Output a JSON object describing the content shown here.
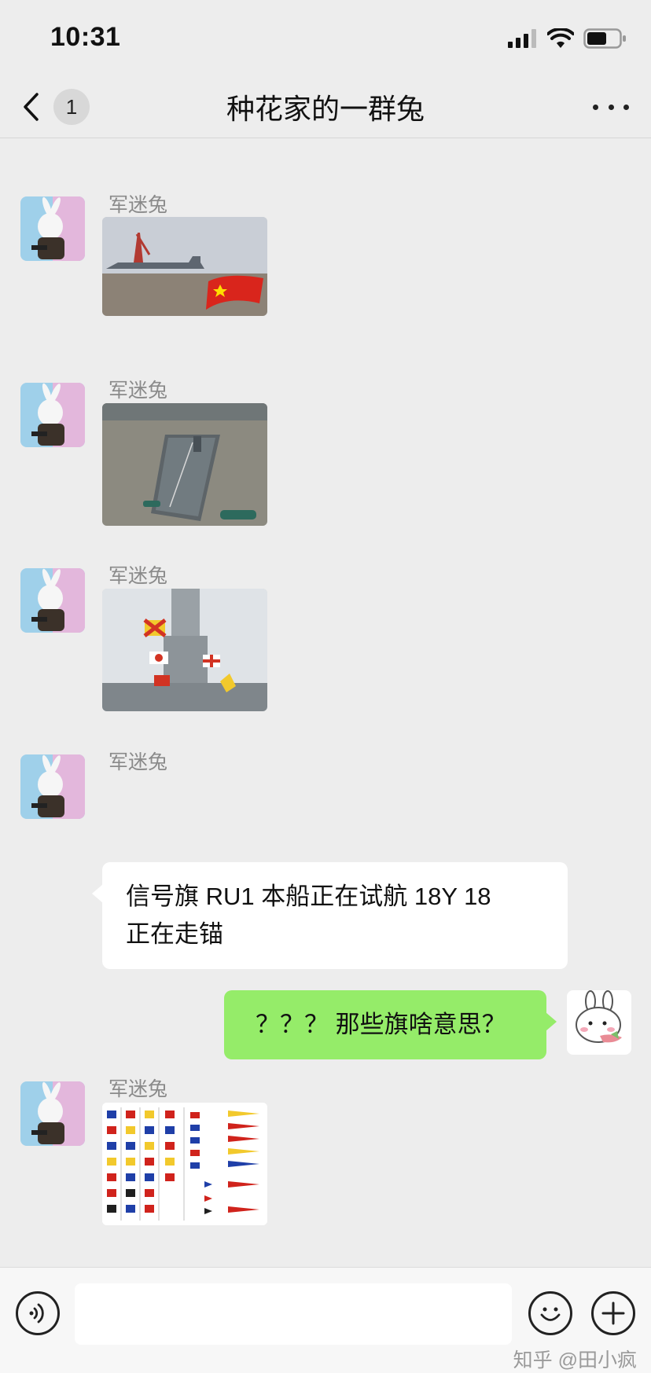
{
  "status_bar": {
    "time": "10:31"
  },
  "nav": {
    "unread_count": "1",
    "title": "种花家的一群兔"
  },
  "messages": {
    "m1": {
      "sender": "军迷兔"
    },
    "m2": {
      "sender": "军迷兔"
    },
    "m3": {
      "sender": "军迷兔"
    },
    "m4": {
      "sender": "军迷兔",
      "line1": "信号旗 RU1 本船正在试航 18Y 18",
      "line2": "正在走锚"
    },
    "m5": {
      "text": "？？？ 那些旗啥意思？"
    },
    "m6": {
      "sender": "军迷兔"
    }
  },
  "input_bar": {
    "placeholder": "",
    "watermark": "知乎 @田小疯"
  },
  "icons": {
    "back": "chevron-left-icon",
    "more": "more-dots-icon",
    "voice": "voice-icon",
    "emoji": "emoji-icon",
    "plus": "plus-icon"
  },
  "colors": {
    "background": "#ededed",
    "my_bubble": "#95ec69",
    "other_bubble": "#ffffff"
  }
}
